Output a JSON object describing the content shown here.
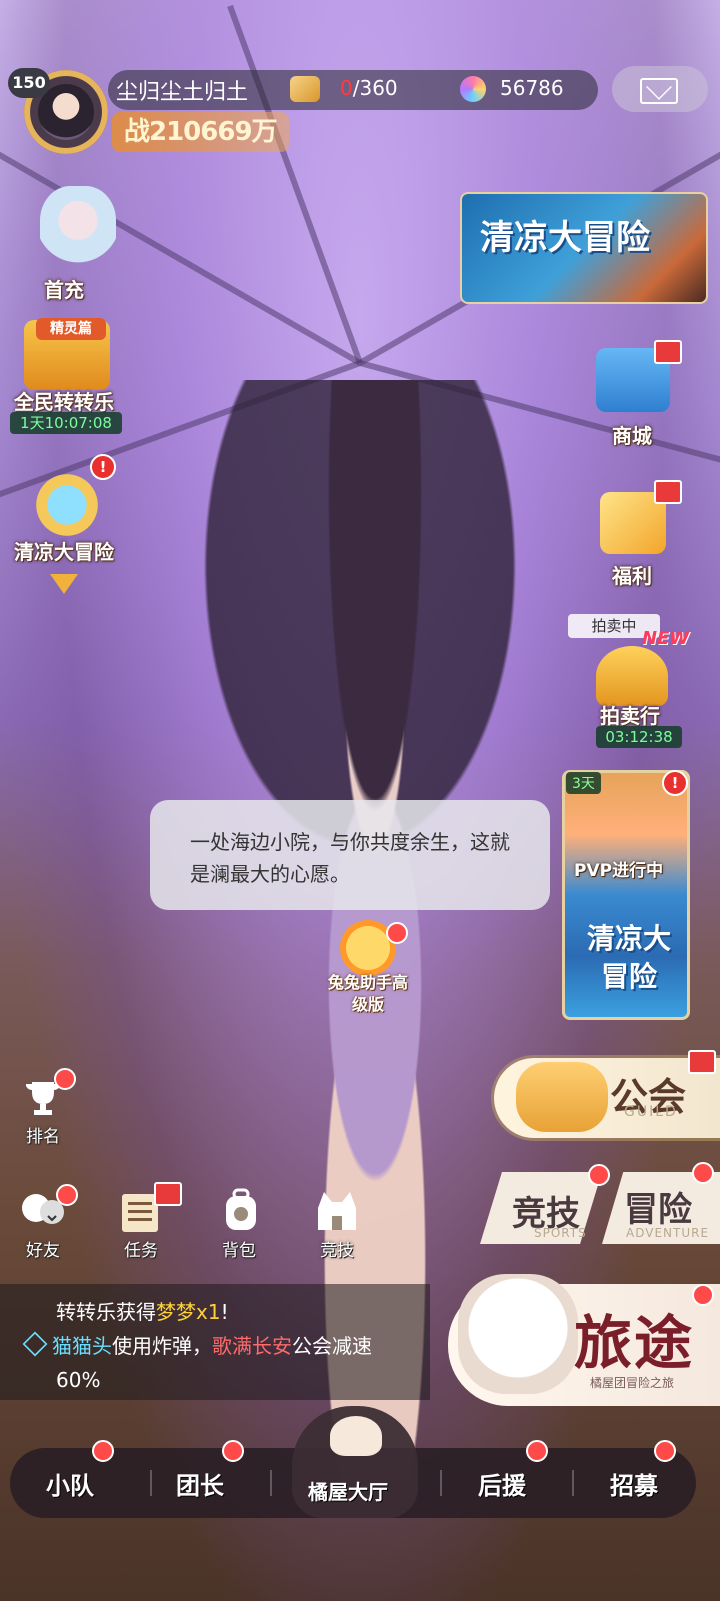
{
  "player": {
    "level": "150",
    "nickname": "尘归尘土归土",
    "power": "战210669万",
    "energy_current": "0",
    "energy_max": "/360",
    "gems": "56786"
  },
  "left_menu": {
    "first_charge": "首充",
    "spin_event_tag": "精灵篇",
    "spin_event": "全民转转乐",
    "spin_timer": "1天10:07:08",
    "cool_adventure": "清凉大冒险",
    "alert": "!"
  },
  "right_menu": {
    "event_banner": "清凉大冒险",
    "shop": "商城",
    "welfare": "福利",
    "auction_status": "拍卖中",
    "auction_new": "NEW",
    "auction": "拍卖行",
    "auction_timer": "03:12:38",
    "pvp_days": "3天",
    "pvp_status": "PVP进行中",
    "pvp_title": "清凉大冒险",
    "alert": "!"
  },
  "dialog": {
    "text": "一处海边小院，与你共度余生，这就是澜最大的心愿。"
  },
  "helper": {
    "label": "兔兔助手高级版"
  },
  "quick_menu": {
    "rank": "排名",
    "friends": "好友",
    "tasks": "任务",
    "bag": "背包",
    "dungeon": "竞技"
  },
  "big_buttons": {
    "guild": "公会",
    "guild_sub": "GUILD",
    "arena": "竞技",
    "arena_sub": "SPORTS",
    "adventure": "冒险",
    "adventure_sub": "ADVENTURE",
    "journey": "旅途",
    "journey_sub": "橘屋团冒险之旅"
  },
  "chat": {
    "line1_prefix": "转转乐获得",
    "line1_item": "梦梦x1",
    "line1_suffix": "!",
    "line2_user": "猫猫头",
    "line2_mid": "使用炸弹，",
    "line2_guild": "歌满长安",
    "line2_suffix": "公会减速",
    "line3": "60%"
  },
  "bottom_nav": {
    "team": "小队",
    "leader": "团长",
    "hall": "橘屋大厅",
    "support": "后援",
    "recruit": "招募"
  },
  "colors": {
    "alert_red": "#e8302e",
    "timer_green": "#7aff9a",
    "highlight_yellow": "#ffd23a",
    "highlight_cyan": "#6adfff"
  }
}
